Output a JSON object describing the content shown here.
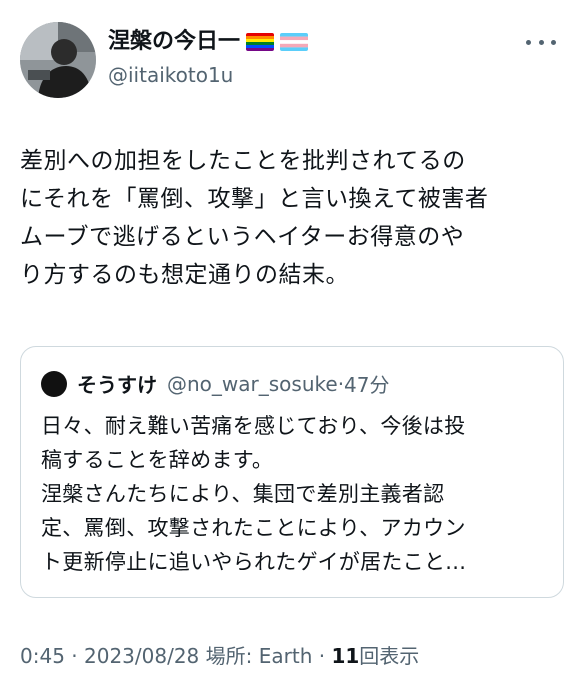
{
  "author": {
    "display_name": "涅槃の今日一",
    "handle": "@iitaikoto1u",
    "flags": [
      "rainbow-flag-icon",
      "transgender-flag-icon"
    ]
  },
  "tweet": {
    "lines": [
      "差別への加担をしたことを批判されてるの",
      "にそれを「罵倒、攻撃」と言い換えて被害者",
      "ムーブで逃げるというヘイターお得意のや",
      "り方するのも想定通りの結末。"
    ]
  },
  "quote": {
    "display_name": "そうすけ",
    "handle": "@no_war_sosuke",
    "separator": "·",
    "time": "47分",
    "lines": [
      "日々、耐え難い苦痛を感じており、今後は投",
      "稿することを辞めます。",
      "涅槃さんたちにより、集団で差別主義者認",
      "定、罵倒、攻撃されたことにより、アカウン",
      "ト更新停止に追いやられたゲイが居たこと..."
    ]
  },
  "meta": {
    "time": "0:45",
    "sep1": "·",
    "date": "2023/08/28",
    "location_label": "場所: Earth",
    "sep2": "·",
    "views_count": "11",
    "views_label": "回表示"
  },
  "colors": {
    "text": "#0f1419",
    "secondary": "#536471",
    "border": "#cfd9de"
  }
}
